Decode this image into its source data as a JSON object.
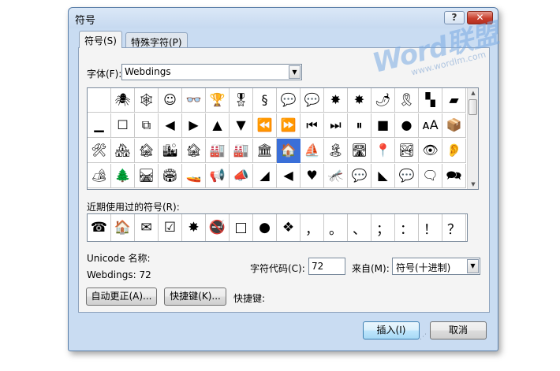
{
  "window": {
    "title": "符号",
    "help_label": "?",
    "close_label": "✕"
  },
  "tabs": [
    {
      "label": "符号(S)"
    },
    {
      "label": "特殊字符(P)"
    }
  ],
  "font": {
    "label": "字体(F):",
    "value": "Webdings"
  },
  "grid": {
    "selected_index": 40,
    "symbols": [
      "",
      "🕷",
      "🕸",
      "☺",
      "👓",
      "🏆",
      "🎖",
      "§",
      "💬",
      "💬",
      "✸",
      "✸",
      "🌶",
      "🎗",
      "▚",
      "▰",
      "▁",
      "☐",
      "⧉",
      "◀",
      "▶",
      "▲",
      "▼",
      "⏪",
      "⏩",
      "⏮",
      "⏭",
      "⏸",
      "■",
      "●",
      "ᴀA",
      "📦",
      "🛠",
      "🏘",
      "🏚",
      "🏙",
      "🏚",
      "🏭",
      "🏭",
      "🏛",
      "🏠",
      "⛵",
      "🏝",
      "🛣",
      "📍",
      "🏞",
      "👁",
      "👂",
      "🏕",
      "🌲",
      "🛤",
      "🏟",
      "🚤",
      "📢",
      "📣",
      "◢",
      "◀",
      "♥",
      "🦟",
      "💬",
      "◣",
      "💬",
      "🗨",
      "🗪"
    ]
  },
  "recent": {
    "label": "近期使用过的符号(R):",
    "symbols": [
      "☎",
      "🏠",
      "✉",
      "☑",
      "✸",
      "🚭",
      "□",
      "●",
      "❖",
      "，",
      "。",
      "、",
      "；",
      "：",
      "！",
      "？"
    ]
  },
  "info": {
    "unicode_name_label": "Unicode 名称:",
    "char_name": "Webdings: 72",
    "charcode_label": "字符代码(C):",
    "charcode_value": "72",
    "from_label": "来自(M):",
    "from_value": "符号(十进制)",
    "shortcut_label": "快捷键:"
  },
  "buttons": {
    "autocorrect": "自动更正(A)...",
    "shortcut": "快捷键(K)...",
    "insert": "插入(I)",
    "cancel": "取消"
  },
  "watermark": {
    "main": "Word联盟",
    "url": "www.wordlm.com"
  },
  "colors": {
    "window_bg": "#c9dcf2",
    "selection": "#3a6fd8",
    "close_button": "#c9412f"
  }
}
